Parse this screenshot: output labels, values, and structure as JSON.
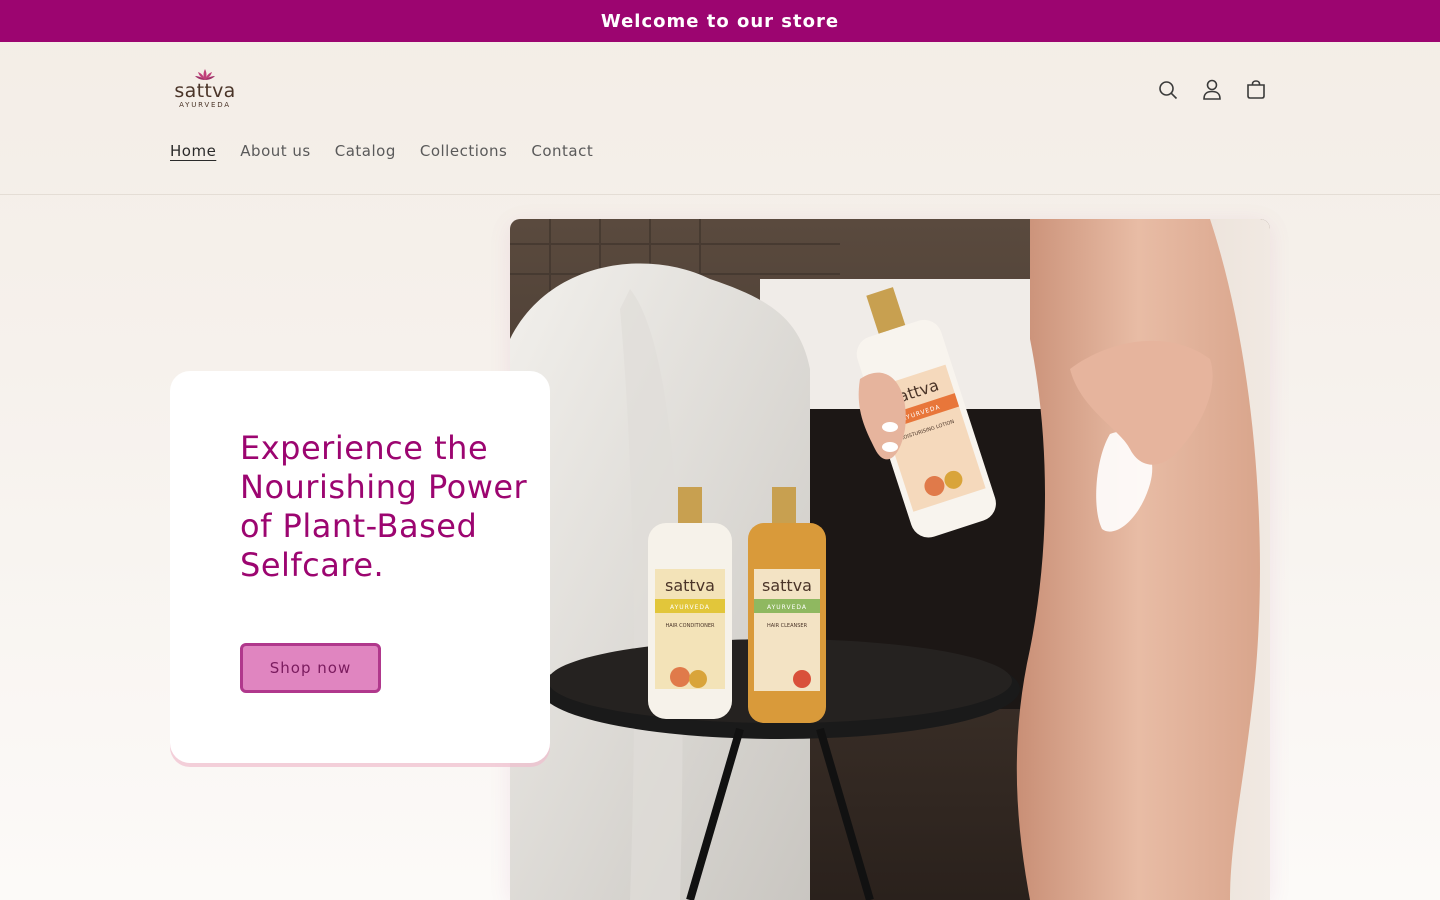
{
  "announcement": {
    "text": "Welcome to our store"
  },
  "logo": {
    "word": "sattva",
    "subtitle": "AYURVEDA"
  },
  "nav": {
    "items": [
      {
        "label": "Home",
        "active": true
      },
      {
        "label": "About us"
      },
      {
        "label": "Catalog"
      },
      {
        "label": "Collections"
      },
      {
        "label": "Contact"
      }
    ]
  },
  "icons": {
    "search": "search-icon",
    "account": "account-icon",
    "cart": "cart-icon"
  },
  "hero": {
    "heading": "Experience the Nourishing Power of Plant-Based Selfcare.",
    "button_label": "Shop now",
    "image": {
      "bottle_brand": "sattva",
      "bottle_sub": "AYURVEDA",
      "bottle_labels": [
        "HAIR CONDITIONER",
        "HAIR CLEANSER",
        "MOISTURISING LOTION"
      ]
    }
  },
  "colors": {
    "brand": "#9c0570",
    "button_fill": "#e085c0",
    "button_border": "#b0388c",
    "background": "#f3ede6"
  }
}
